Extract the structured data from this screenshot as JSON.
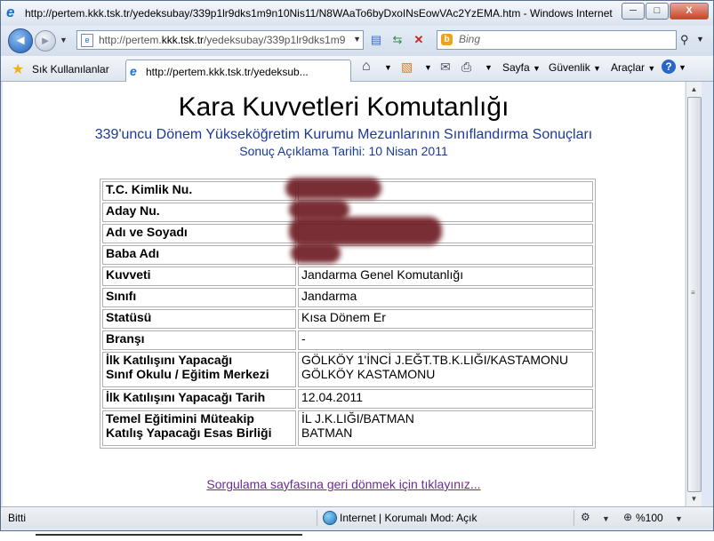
{
  "window": {
    "title": "http://pertem.kkk.tsk.tr/yedeksubay/339p1lr9dks1m9n10Nis11/N8WAaTo6byDxoINsEowVAc2YzEMA.htm - Windows Internet Explorer",
    "minimize": "─",
    "maximize": "□",
    "close": "X"
  },
  "nav": {
    "back_glyph": "◄",
    "forward_glyph": "►",
    "address_host_prefix": "http://pertem.",
    "address_host": "kkk.tsk.tr",
    "address_path": "/yedeksubay/339p1lr9dks1m9",
    "search_placeholder": "Bing"
  },
  "favorites": {
    "label": "Sık Kullanılanlar",
    "tab_title": "http://pertem.kkk.tsk.tr/yedeksub..."
  },
  "commands": {
    "page": "Sayfa",
    "safety": "Güvenlik",
    "tools": "Araçlar"
  },
  "page": {
    "title": "Kara Kuvvetleri Komutanlığı",
    "subtitle": "339'uncu Dönem Yükseköğretim Kurumu Mezunlarının Sınıflandırma Sonuçları",
    "date": "Sonuç Açıklama Tarihi: 10 Nisan 2011",
    "rows": [
      {
        "label": "T.C. Kimlik Nu.",
        "value": ""
      },
      {
        "label": "Aday Nu.",
        "value": ""
      },
      {
        "label": "Adı ve Soyadı",
        "value": ""
      },
      {
        "label": "Baba Adı",
        "value": ""
      },
      {
        "label": "Kuvveti",
        "value": "Jandarma Genel Komutanlığı"
      },
      {
        "label": "Sınıfı",
        "value": "Jandarma"
      },
      {
        "label": "Statüsü",
        "value": "Kısa Dönem Er"
      },
      {
        "label": "Branşı",
        "value": "-"
      },
      {
        "label": "İlk Katılışını Yapacağı",
        "label2": "Sınıf Okulu / Eğitim Merkezi",
        "value": "GÖLKÖY 1'İNCİ J.EĞT.TB.K.LIĞI/KASTAMONU",
        "value2": "GÖLKÖY KASTAMONU"
      },
      {
        "label": "İlk Katılışını Yapacağı Tarih",
        "value": "12.04.2011"
      },
      {
        "label": "Temel Eğitimini Müteakip",
        "label2": "Katılış Yapacağı Esas Birliği",
        "value": "İL J.K.LIĞI/BATMAN",
        "value2": "BATMAN"
      }
    ],
    "back_link": "Sorgulama sayfasına geri dönmek için tıklayınız..."
  },
  "status": {
    "left": "Bitti",
    "zone": "Internet | Korumalı Mod: Açık",
    "zoom": "%100"
  }
}
